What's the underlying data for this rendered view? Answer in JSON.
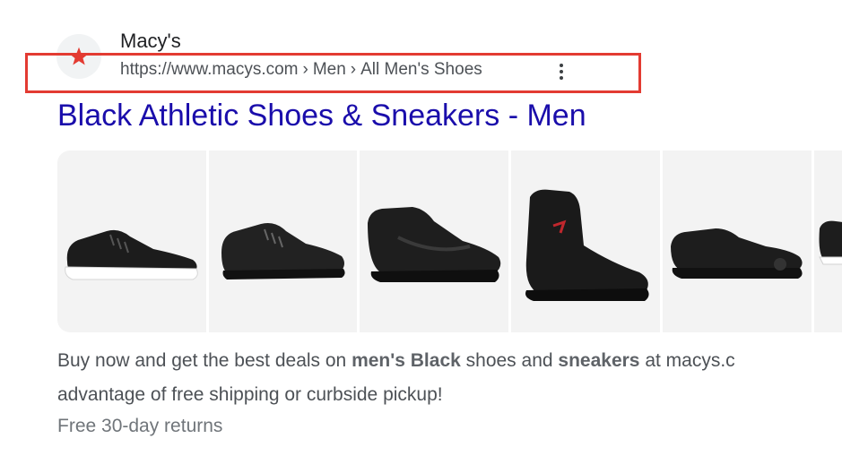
{
  "result": {
    "site_name": "Macy's",
    "url": {
      "domain": "https://www.macys.com",
      "separator": "›",
      "crumbs": [
        "Men",
        "All Men's Shoes"
      ]
    },
    "more_icon": "three-dots-vertical-icon",
    "favicon_icon": "star-icon",
    "brand_color": "#e33b32",
    "title": "Black Athletic Shoes & Sneakers - Men",
    "title_color": "#1a0dab",
    "images": [
      {
        "alt": "black low-top leather sneaker with white sole"
      },
      {
        "alt": "black leather low-top sneaker"
      },
      {
        "alt": "black low-top athletic sneaker"
      },
      {
        "alt": "black high-top knit sneaker"
      },
      {
        "alt": "black running sneaker"
      },
      {
        "alt": "black sneaker partially visible"
      }
    ],
    "snippet": {
      "line1": [
        {
          "text": "Buy now and get the best deals on ",
          "bold": false
        },
        {
          "text": "men's Black",
          "bold": true
        },
        {
          "text": " shoes and ",
          "bold": false
        },
        {
          "text": "sneakers",
          "bold": true
        },
        {
          "text": " at macys.c",
          "bold": false
        }
      ],
      "line2": "advantage of free shipping or curbside pickup!"
    },
    "extra": "Free 30-day returns"
  }
}
